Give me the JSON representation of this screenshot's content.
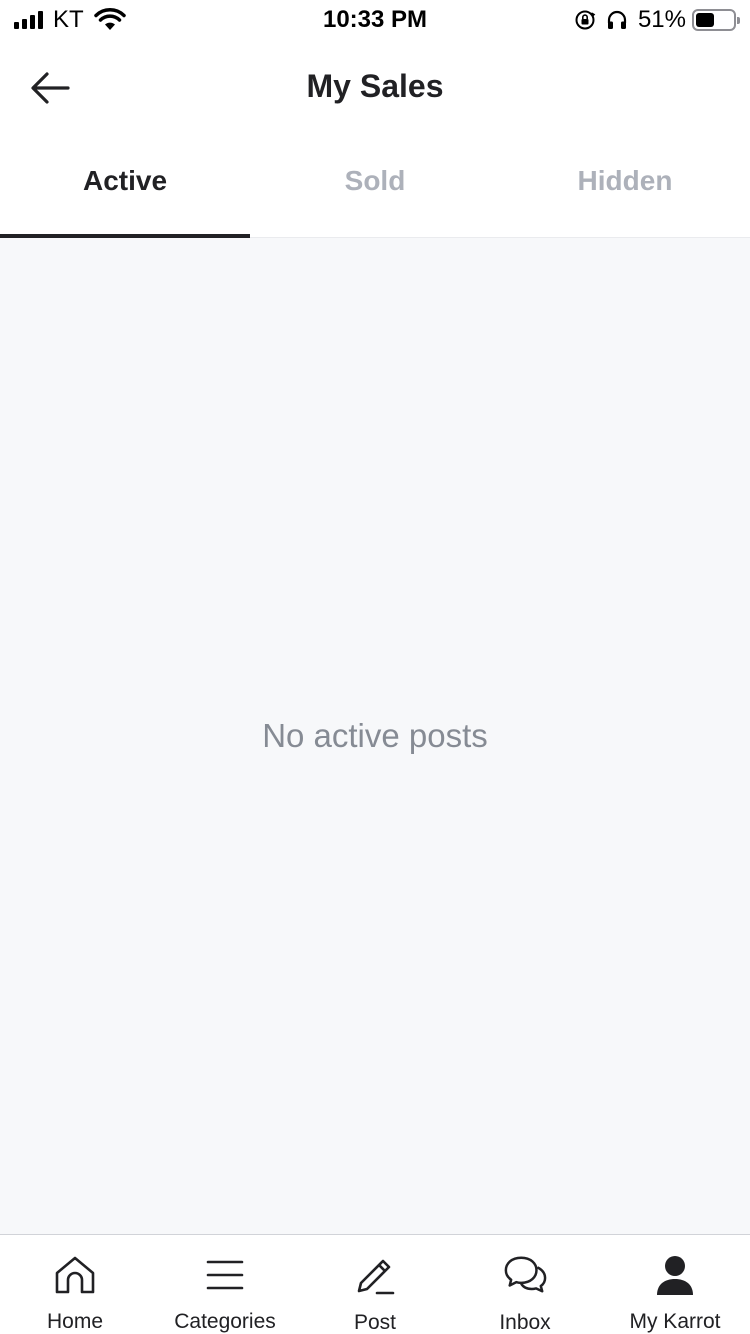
{
  "status_bar": {
    "carrier": "KT",
    "time": "10:33 PM",
    "battery_percent": "51%",
    "battery_level": 0.51
  },
  "header": {
    "title": "My Sales",
    "back_icon": "arrow-left-icon"
  },
  "tabs": [
    {
      "label": "Active",
      "selected": true
    },
    {
      "label": "Sold",
      "selected": false
    },
    {
      "label": "Hidden",
      "selected": false
    }
  ],
  "content": {
    "empty_message": "No active posts"
  },
  "bottom_nav": {
    "items": [
      {
        "label": "Home",
        "icon": "home-icon"
      },
      {
        "label": "Categories",
        "icon": "menu-icon"
      },
      {
        "label": "Post",
        "icon": "pencil-icon"
      },
      {
        "label": "Inbox",
        "icon": "chat-icon"
      },
      {
        "label": "My Karrot",
        "icon": "person-icon"
      }
    ]
  },
  "colors": {
    "text_primary": "#212124",
    "text_inactive": "#adb1ba",
    "empty_text": "#868b94",
    "content_bg": "#f7f8fa"
  }
}
